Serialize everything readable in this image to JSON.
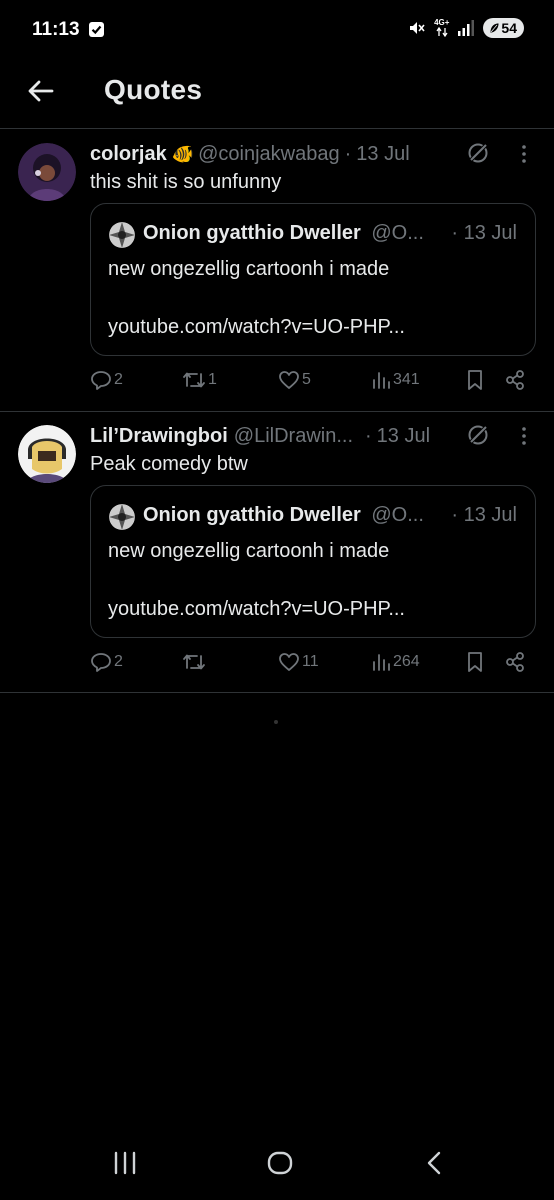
{
  "status_bar": {
    "time": "11:13",
    "network_label": "4G+",
    "battery": "54"
  },
  "header": {
    "title": "Quotes"
  },
  "tweets": [
    {
      "author_name": "colorjak",
      "author_emoji": "🐠",
      "handle": "@coinjakwabag",
      "date": "13 Jul",
      "text": "this shit is so unfunny",
      "quote": {
        "author_name": "Onion gyatthio Dweller",
        "handle": "@O...",
        "date": "13 Jul",
        "text": "new ongezellig cartoonh i made",
        "link": "youtube.com/watch?v=UO-PHP..."
      },
      "replies": "2",
      "reposts": "1",
      "likes": "5",
      "views": "341"
    },
    {
      "author_name": "Lil’Drawingboi",
      "handle": "@LilDrawin...",
      "date": "13 Jul",
      "text": "Peak comedy btw",
      "quote": {
        "author_name": "Onion gyatthio Dweller",
        "handle": "@O...",
        "date": "13 Jul",
        "text": "new ongezellig cartoonh i made",
        "link": "youtube.com/watch?v=UO-PHP..."
      },
      "replies": "2",
      "reposts": "",
      "likes": "11",
      "views": "264"
    }
  ],
  "icons": {
    "back": "arrow-left-icon",
    "grok": "grok-icon",
    "more": "more-vertical-icon",
    "reply": "reply-icon",
    "repost": "repost-icon",
    "like": "heart-icon",
    "views": "views-icon",
    "bookmark": "bookmark-icon",
    "share": "share-icon"
  },
  "colors": {
    "background": "#000000",
    "text": "#e7e9ea",
    "muted": "#71767b",
    "divider": "#2f3336"
  }
}
